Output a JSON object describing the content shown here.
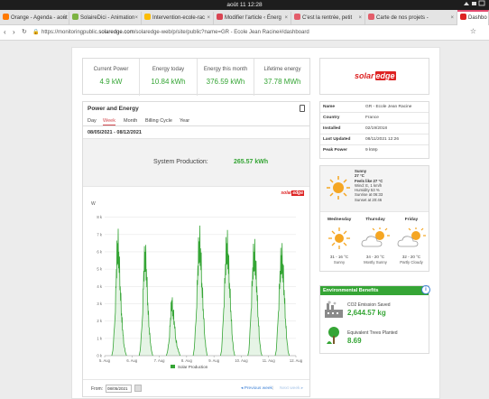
{
  "system_bar": {
    "clock": "août 11  12:28"
  },
  "tabs": [
    {
      "label": "Orange - Agenda - août",
      "icon": "orange-icon",
      "color": "#ff7900"
    },
    {
      "label": "SolaireDici - Animation",
      "icon": "solairedici-icon",
      "color": "#7cb342"
    },
    {
      "label": "Intervention-ecole-rac",
      "icon": "drive-icon",
      "color": "#fbbc04"
    },
    {
      "label": "Modifier l'article ‹ Énerg",
      "icon": "wordpress-icon",
      "color": "#d94452"
    },
    {
      "label": "C'est la rentrée, petit",
      "icon": "page-icon",
      "color": "#e35d6a"
    },
    {
      "label": "Carte de nos projets - ",
      "icon": "map-icon",
      "color": "#e35d6a"
    },
    {
      "label": "Dashbo",
      "icon": "solaredge-icon",
      "color": "#d22"
    }
  ],
  "address_bar": {
    "url_prefix": "https://monitoringpublic.",
    "url_domain": "solaredge.com",
    "url_path": "/solaredge-web/p/site/public?name=GR - Ecole Jean Racine#/dashboard"
  },
  "kpis": [
    {
      "label": "Current Power",
      "value": "4.9 kW"
    },
    {
      "label": "Energy today",
      "value": "10.84 kWh"
    },
    {
      "label": "Energy this month",
      "value": "376.59 kWh"
    },
    {
      "label": "Lifetime energy",
      "value": "37.78 MWh"
    }
  ],
  "brand": {
    "name": "solar",
    "suffix": "edge",
    "color": "#d22"
  },
  "power_energy": {
    "title": "Power and Energy",
    "tabs": [
      "Day",
      "Week",
      "Month",
      "Billing Cycle",
      "Year"
    ],
    "active_tab": "Week",
    "range": "08/05/2021 - 08/12/2021",
    "production_label": "System Production:",
    "production_value": "265.57 kWh",
    "from_label": "From:",
    "from_value": "08/05/2021",
    "prev_label": "◂ Previous week",
    "separator": "|",
    "next_label": "Next week ▸"
  },
  "chart_data": {
    "type": "area",
    "title": "",
    "xlabel": "",
    "ylabel": "W",
    "y_ticks": [
      "0 k",
      "1 k",
      "2 k",
      "3 k",
      "4 k",
      "5 k",
      "6 k",
      "7 k",
      "8 k"
    ],
    "x_ticks": [
      "5. Aug",
      "6. Aug",
      "7. Aug",
      "8. Aug",
      "9. Aug",
      "10. Aug",
      "11. Aug",
      "12. Aug"
    ],
    "ylim": [
      0,
      8500
    ],
    "xlim": [
      0,
      7
    ],
    "grid": true,
    "legend": {
      "position": "bottom-center",
      "entries": [
        "Solar Production"
      ]
    },
    "series": [
      {
        "name": "Solar Production",
        "color": "#35a535",
        "days": [
          {
            "day": 0,
            "peaks": [
              [
                0.3,
                300
              ],
              [
                0.38,
                2200
              ],
              [
                0.43,
                5000
              ],
              [
                0.47,
                6500
              ],
              [
                0.52,
                6000
              ],
              [
                0.57,
                4000
              ],
              [
                0.62,
                2400
              ],
              [
                0.66,
                1500
              ],
              [
                0.71,
                600
              ],
              [
                0.76,
                200
              ]
            ]
          },
          {
            "day": 1,
            "peaks": [
              [
                0.3,
                300
              ],
              [
                0.38,
                2100
              ],
              [
                0.43,
                4900
              ],
              [
                0.48,
                6000
              ],
              [
                0.53,
                5000
              ],
              [
                0.58,
                3000
              ],
              [
                0.63,
                1600
              ],
              [
                0.68,
                700
              ],
              [
                0.72,
                250
              ]
            ]
          },
          {
            "day": 2,
            "peaks": [
              [
                0.3,
                250
              ],
              [
                0.36,
                900
              ],
              [
                0.41,
                2200
              ],
              [
                0.45,
                3200
              ],
              [
                0.5,
                2600
              ],
              [
                0.55,
                2000
              ],
              [
                0.6,
                1000
              ],
              [
                0.66,
                500
              ],
              [
                0.72,
                200
              ]
            ]
          },
          {
            "day": 3,
            "peaks": [
              [
                0.28,
                400
              ],
              [
                0.36,
                2600
              ],
              [
                0.41,
                5200
              ],
              [
                0.46,
                6600
              ],
              [
                0.51,
                6200
              ],
              [
                0.56,
                4200
              ],
              [
                0.61,
                2700
              ],
              [
                0.66,
                1200
              ],
              [
                0.71,
                400
              ]
            ]
          },
          {
            "day": 4,
            "peaks": [
              [
                0.28,
                300
              ],
              [
                0.36,
                2700
              ],
              [
                0.42,
                5300
              ],
              [
                0.47,
                6500
              ],
              [
                0.52,
                5900
              ],
              [
                0.57,
                4200
              ],
              [
                0.62,
                2600
              ],
              [
                0.67,
                1100
              ],
              [
                0.72,
                300
              ]
            ]
          },
          {
            "day": 5,
            "peaks": [
              [
                0.28,
                300
              ],
              [
                0.36,
                2600
              ],
              [
                0.42,
                5100
              ],
              [
                0.47,
                6000
              ],
              [
                0.52,
                5500
              ],
              [
                0.57,
                4000
              ],
              [
                0.62,
                2200
              ],
              [
                0.67,
                900
              ],
              [
                0.72,
                200
              ]
            ]
          },
          {
            "day": 6,
            "peaks": [
              [
                0.28,
                300
              ],
              [
                0.36,
                2500
              ],
              [
                0.42,
                4900
              ],
              [
                0.47,
                5800
              ],
              [
                0.52,
                5300
              ],
              [
                0.57,
                3800
              ],
              [
                0.62,
                2100
              ],
              [
                0.67,
                900
              ],
              [
                0.72,
                200
              ]
            ]
          }
        ]
      }
    ]
  },
  "site_info": [
    {
      "key": "Name",
      "value": "GR - Ecole Jean Racine"
    },
    {
      "key": "Country",
      "value": "France"
    },
    {
      "key": "Installed",
      "value": "02/19/2018"
    },
    {
      "key": "Last Updated",
      "value": "08/11/2021 12:26"
    },
    {
      "key": "Peak Power",
      "value": "9 kWp"
    }
  ],
  "weather": {
    "current": {
      "condition": "Sunny",
      "temp": "27 °C",
      "feels": "Feels like 27 °C",
      "wind": "Wind: E, 1 km/h",
      "humidity": "Humidity 53 %",
      "sunrise": "Sunrise at 06:33",
      "sunset": "Sunset at 20:46",
      "icon": "sun-icon"
    },
    "forecast": [
      {
        "day": "Wednesday",
        "temps": "31 - 16 °C",
        "condition": "Sunny",
        "icon": "sun-icon"
      },
      {
        "day": "Thursday",
        "temps": "34 - 20 °C",
        "condition": "Mostly Sunny",
        "icon": "sun-cloud-icon"
      },
      {
        "day": "Friday",
        "temps": "32 - 20 °C",
        "condition": "Partly Cloudy",
        "icon": "sun-cloud-icon"
      }
    ]
  },
  "env_benefits": {
    "title": "Environmental Benefits",
    "info": "i",
    "co2_label": "CO2 Emission Saved",
    "co2_value": "2,644.57 kg",
    "trees_label": "Equivalent Trees Planted",
    "trees_value": "8.69"
  }
}
